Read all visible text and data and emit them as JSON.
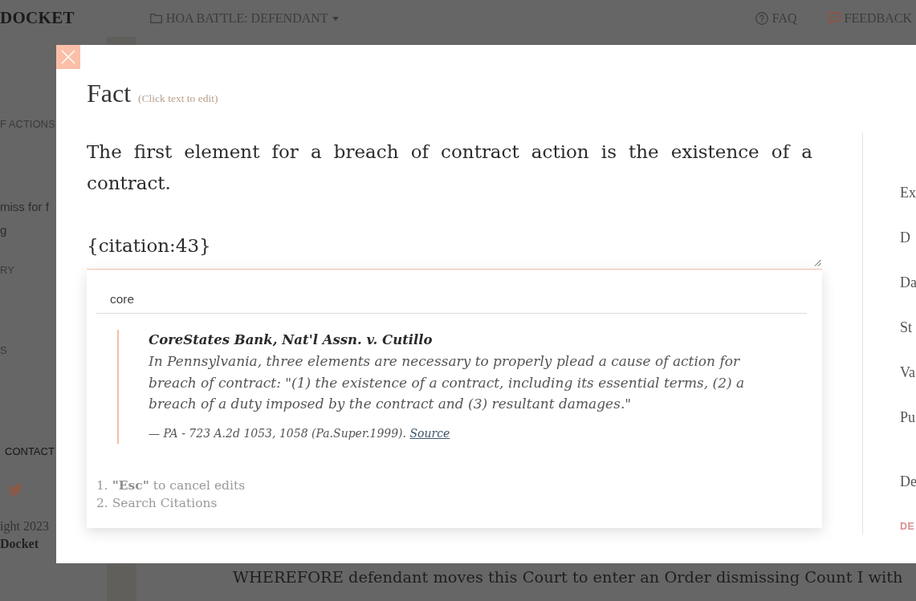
{
  "top_bar": {
    "logo": "DOCKET",
    "case_menu": {
      "label": "HOA BATTLE: DEFENDANT"
    },
    "links": [
      {
        "kind": "help",
        "label": "FAQ"
      },
      {
        "kind": "feedback",
        "label": "FEEDBACK"
      }
    ]
  },
  "sidebar": {
    "items": [
      {
        "kind": "heading",
        "text": "F ACTIONS"
      },
      {
        "kind": "link",
        "text": "miss for f"
      },
      {
        "kind": "link",
        "text": "g"
      },
      {
        "kind": "heading",
        "text": "RY"
      },
      {
        "kind": "heading",
        "text": "S"
      }
    ],
    "contact": "CONTACT",
    "copyright": "ight 2023",
    "brand": "Docket"
  },
  "document": {
    "paragraph": "WHEREFORE defendant moves this Court to enter an Order dismissing Count I with"
  },
  "modal": {
    "title": "Fact",
    "hint": "(Click text to edit)",
    "editor": {
      "paragraphs": [
        "The first element for a breach of contract action is the existence of a contract.",
        "{citation:43}"
      ]
    },
    "citation_search": {
      "value": "core",
      "results": [
        {
          "title": "CoreStates Bank, Nat'l Assn. v. Cutillo",
          "quote": "In Pennsylvania, three elements are necessary to properly plead a cause of action for breach of contract: \"(1) the existence of a contract, including its essential terms, (2) a breach of a duty imposed by the contract and (3) resultant damages.\"",
          "reference": "— PA - 723 A.2d 1053, 1058 (Pa.Super.1999).",
          "link": "Source"
        }
      ],
      "tips": [
        {
          "number": "1.",
          "text": "**\"Esc\"** to cancel edits"
        },
        {
          "number": "2.",
          "text": "Search Citations"
        }
      ]
    },
    "side_labels": [
      {
        "kind": "label",
        "text": "Ex"
      },
      {
        "kind": "label",
        "text": "D"
      },
      {
        "kind": "label",
        "text": "Da"
      },
      {
        "kind": "label",
        "text": "St"
      },
      {
        "kind": "label",
        "text": "Va"
      },
      {
        "kind": "label",
        "text": "Pu"
      },
      {
        "kind": "label",
        "text": "De"
      },
      {
        "kind": "action",
        "text": "DE"
      }
    ]
  }
}
